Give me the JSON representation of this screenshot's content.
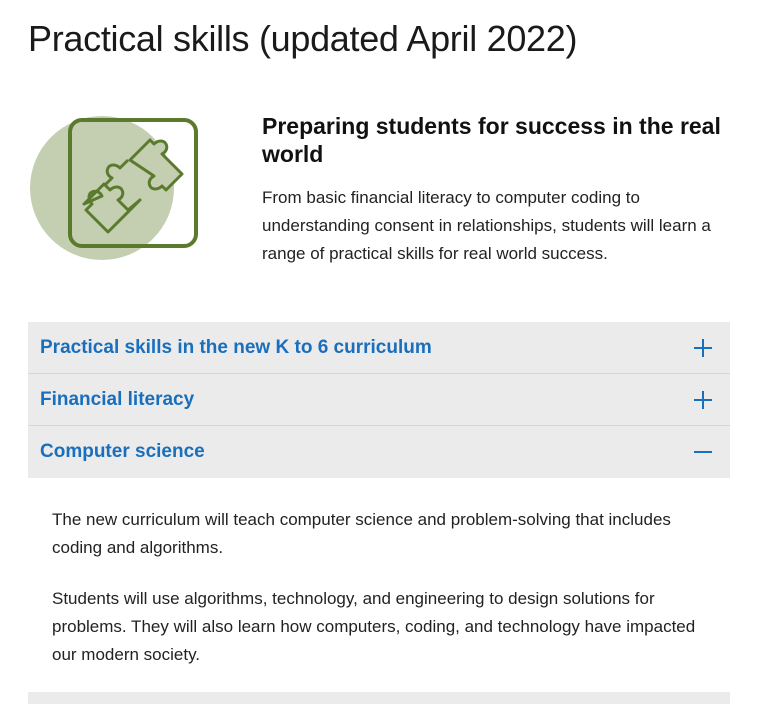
{
  "page": {
    "title": "Practical skills (updated April 2022)"
  },
  "intro": {
    "icon": "puzzle-pieces-icon",
    "heading": "Preparing students for success in the real world",
    "body": "From basic financial literacy to computer coding to understanding consent in relationships, students will learn a range of practical skills for real world success."
  },
  "accordion": {
    "items": [
      {
        "title": "Practical skills in the new K to 6 curriculum",
        "expanded": false,
        "icon": "plus-icon"
      },
      {
        "title": "Financial literacy",
        "expanded": false,
        "icon": "plus-icon"
      },
      {
        "title": "Computer science",
        "expanded": true,
        "icon": "minus-icon",
        "paragraphs": [
          "The new curriculum will teach computer science and problem-solving that includes coding and algorithms.",
          "Students will use algorithms, technology, and engineering to design solutions for problems. They will also learn how computers, coding, and technology have impacted our modern society."
        ]
      }
    ]
  },
  "colors": {
    "link_blue": "#1a6fbd",
    "accordion_bg": "#ebebeb",
    "icon_green": "#5b7a2e",
    "icon_circle": "#c3cfb0"
  }
}
